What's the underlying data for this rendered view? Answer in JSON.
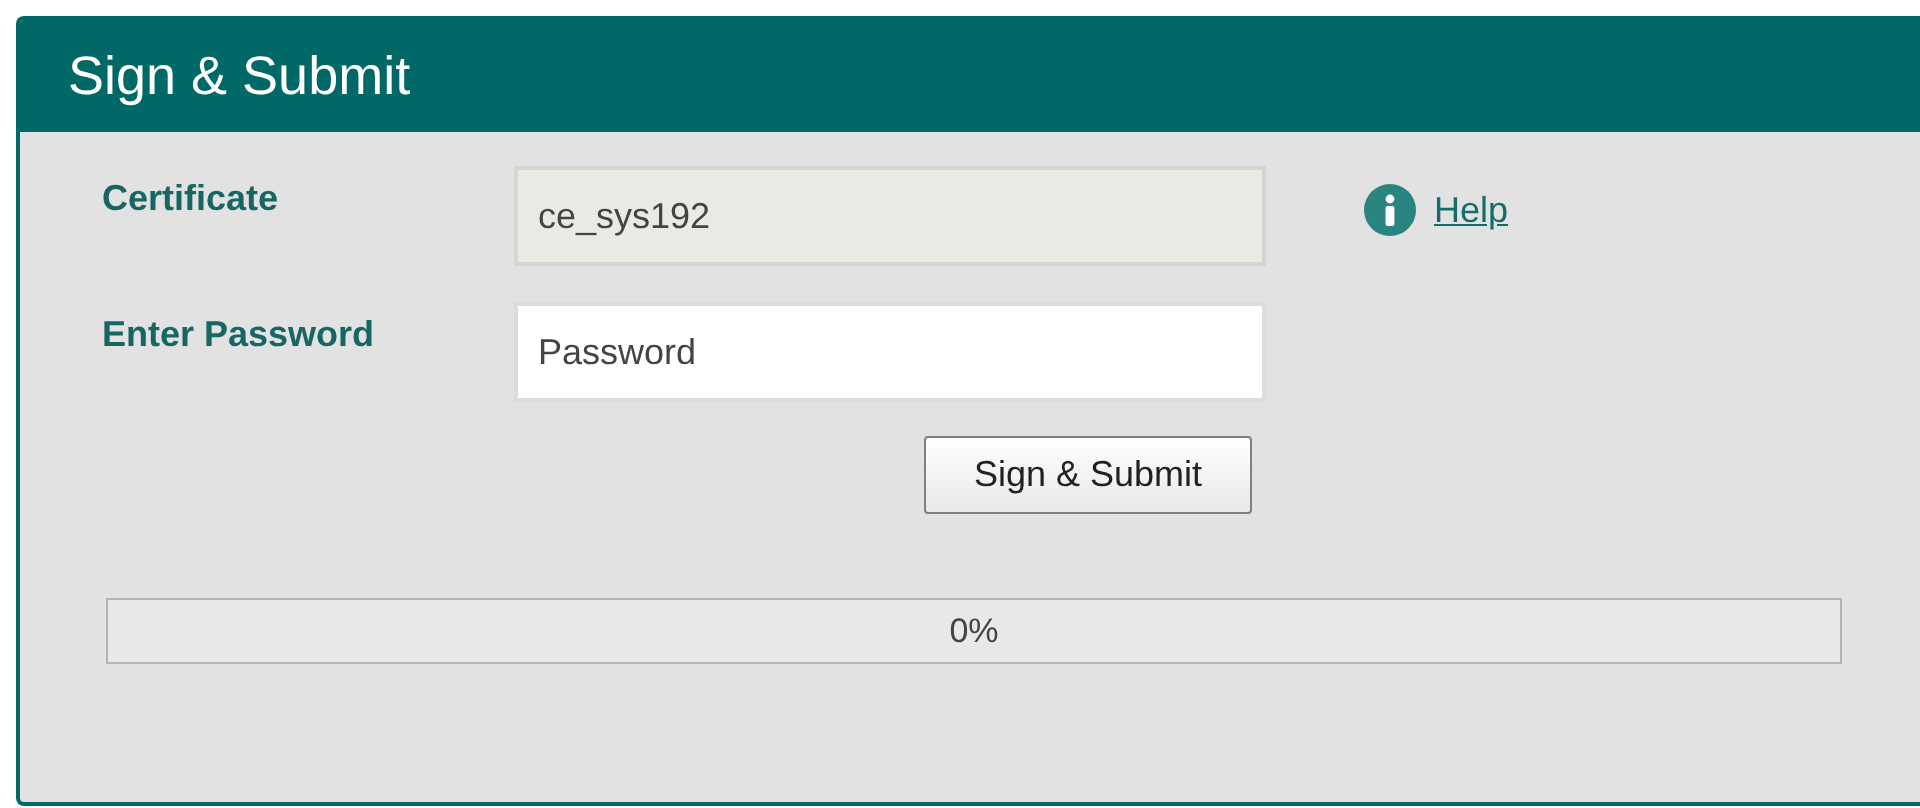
{
  "window": {
    "title": "Sign & Submit"
  },
  "fields": [
    {
      "label": "Certificate",
      "value": "ce_sys192",
      "disabled": true
    },
    {
      "label": "Enter Password",
      "placeholder": "Password",
      "disabled": false
    }
  ],
  "help": {
    "label": "Help"
  },
  "submit_button": {
    "label": "Sign & Submit"
  },
  "progress": {
    "level": 0,
    "reading": "0%"
  }
}
